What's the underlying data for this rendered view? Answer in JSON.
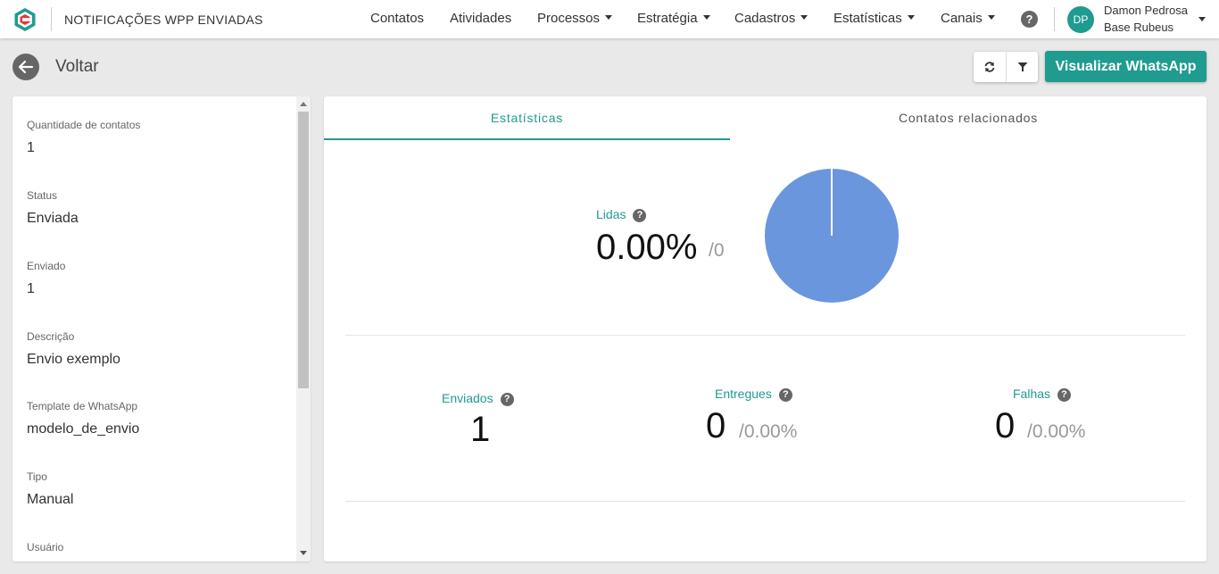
{
  "header": {
    "title": "NOTIFICAÇÕES WPP ENVIADAS",
    "nav": [
      "Contatos",
      "Atividades",
      "Processos",
      "Estratégia",
      "Cadastros",
      "Estatísticas",
      "Canais"
    ],
    "help": "?",
    "user": {
      "initials": "DP",
      "name": "Damon Pedrosa",
      "base": "Base Rubeus"
    }
  },
  "actions": {
    "back_label": "Voltar",
    "whatsapp_button": "Visualizar WhatsApp"
  },
  "details": [
    {
      "label": "Quantidade de contatos",
      "value": "1"
    },
    {
      "label": "Status",
      "value": "Enviada"
    },
    {
      "label": "Enviado",
      "value": "1"
    },
    {
      "label": "Descrição",
      "value": "Envio exemplo"
    },
    {
      "label": "Template de WhatsApp",
      "value": "modelo_de_envio"
    },
    {
      "label": "Tipo",
      "value": "Manual"
    },
    {
      "label": "Usuário",
      "value": ""
    }
  ],
  "tabs": {
    "active": "Estatísticas",
    "other": "Contatos relacionados"
  },
  "stats": {
    "lidas": {
      "label": "Lidas",
      "value": "0.00%",
      "total": "/0"
    },
    "enviados": {
      "label": "Enviados",
      "value": "1"
    },
    "entregues": {
      "label": "Entregues",
      "value": "0",
      "percent": "/0.00%"
    },
    "falhas": {
      "label": "Falhas",
      "value": "0",
      "percent": "/0.00%"
    }
  },
  "colors": {
    "accent": "#1f9b8f",
    "pie": "#6a96de"
  },
  "icons": [
    "logo-icon",
    "help-icon",
    "back-arrow-icon",
    "refresh-icon",
    "filter-icon",
    "chevron-down-icon",
    "scroll-up-icon",
    "scroll-down-icon"
  ]
}
